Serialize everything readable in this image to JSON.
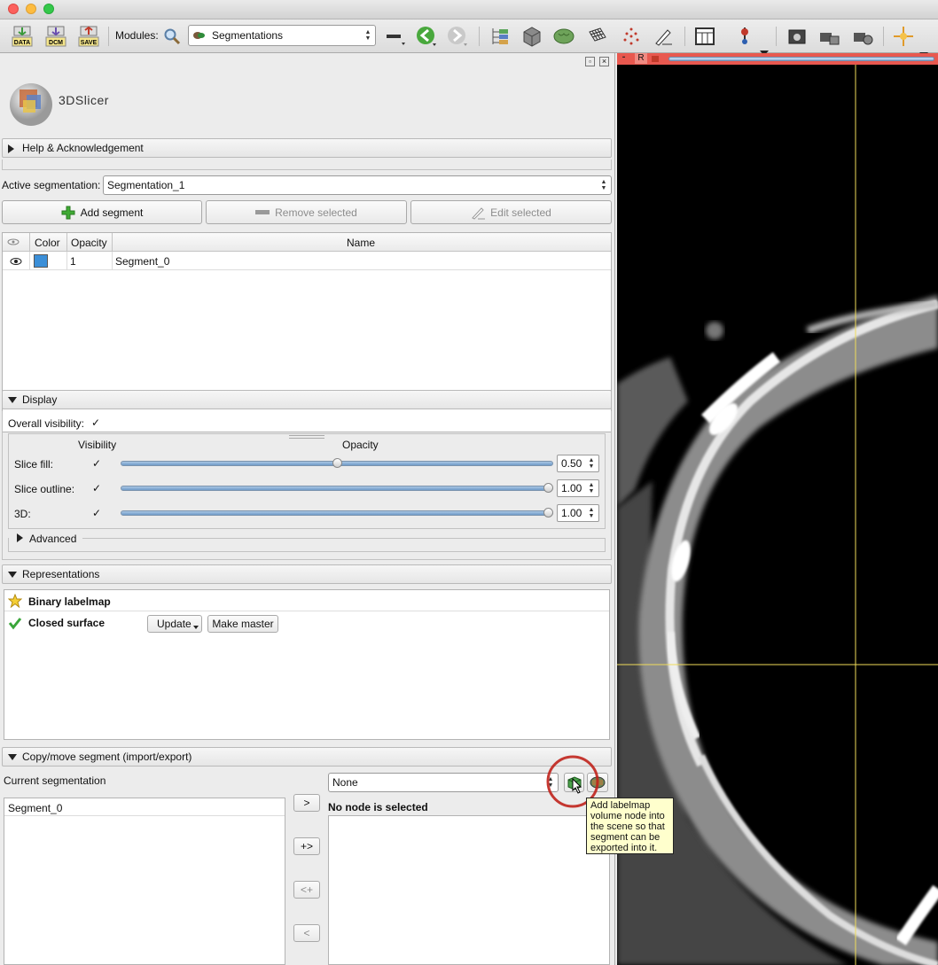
{
  "toolbar": {
    "data_label": "DATA",
    "dcm_label": "DCM",
    "save_label": "SAVE",
    "modules_label": "Modules:",
    "module_selected": "Segmentations"
  },
  "logo": {
    "text": "3DSlicer"
  },
  "sections": {
    "help": "Help & Acknowledgement",
    "display": "Display",
    "advanced": "Advanced",
    "representations": "Representations",
    "copy_move": "Copy/move segment (import/export)"
  },
  "active_segmentation": {
    "label": "Active segmentation:",
    "value": "Segmentation_1"
  },
  "segment_buttons": {
    "add": "Add segment",
    "remove": "Remove selected",
    "edit": "Edit selected"
  },
  "segments_table": {
    "headers": {
      "color": "Color",
      "opacity": "Opacity",
      "name": "Name"
    },
    "rows": [
      {
        "opacity": "1",
        "name": "Segment_0",
        "color": "#3b8fd8"
      }
    ]
  },
  "display": {
    "overall_visibility_label": "Overall visibility:",
    "visibility_header": "Visibility",
    "opacity_header": "Opacity",
    "rows": [
      {
        "label": "Slice fill:",
        "value": "0.50",
        "fraction": 0.5
      },
      {
        "label": "Slice outline:",
        "value": "1.00",
        "fraction": 1.0
      },
      {
        "label": "3D:",
        "value": "1.00",
        "fraction": 1.0
      }
    ]
  },
  "representations": {
    "binary": "Binary labelmap",
    "closed": "Closed surface",
    "update_button": "Update",
    "make_master_button": "Make master"
  },
  "copy_move": {
    "current_label": "Current segmentation",
    "left_items": [
      "Segment_0"
    ],
    "other_select": "None",
    "no_node_label": "No node is selected",
    "move_right": ">",
    "copy_right": "+>",
    "copy_left": "<+",
    "move_left": "<"
  },
  "viewer": {
    "label": "R"
  },
  "tooltip": {
    "text": "Add labelmap volume node into the scene so that segment can be exported into it."
  },
  "colors": {
    "viewer_bar": "#e8584f",
    "accent_circle": "#c0241c",
    "segment_color": "#3b8fd8"
  }
}
